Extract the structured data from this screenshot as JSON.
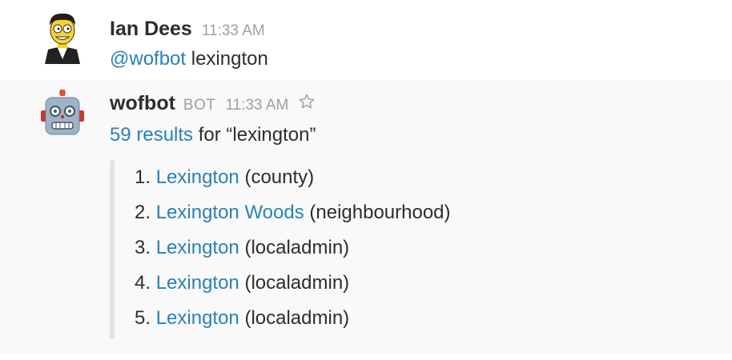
{
  "messages": [
    {
      "author": "Ian Dees",
      "time": "11:33 AM",
      "mention": "@wofbot",
      "text": " lexington"
    },
    {
      "author": "wofbot",
      "bot_tag": "BOT",
      "time": "11:33 AM",
      "star_icon": "star-icon",
      "results_link": "59 results",
      "results_suffix": " for “lexington”",
      "results": [
        {
          "num": "1.",
          "name": "Lexington",
          "type": "(county)"
        },
        {
          "num": "2.",
          "name": "Lexington Woods",
          "type": "(neighbourhood)"
        },
        {
          "num": "3.",
          "name": "Lexington",
          "type": "(localadmin)"
        },
        {
          "num": "4.",
          "name": "Lexington",
          "type": "(localadmin)"
        },
        {
          "num": "5.",
          "name": "Lexington",
          "type": "(localadmin)"
        }
      ]
    }
  ],
  "colors": {
    "link": "#2a80b9",
    "timestamp": "#9e9ea6",
    "hover_bg": "#f9f9f9",
    "attachment_bar": "#e3e3e3"
  }
}
